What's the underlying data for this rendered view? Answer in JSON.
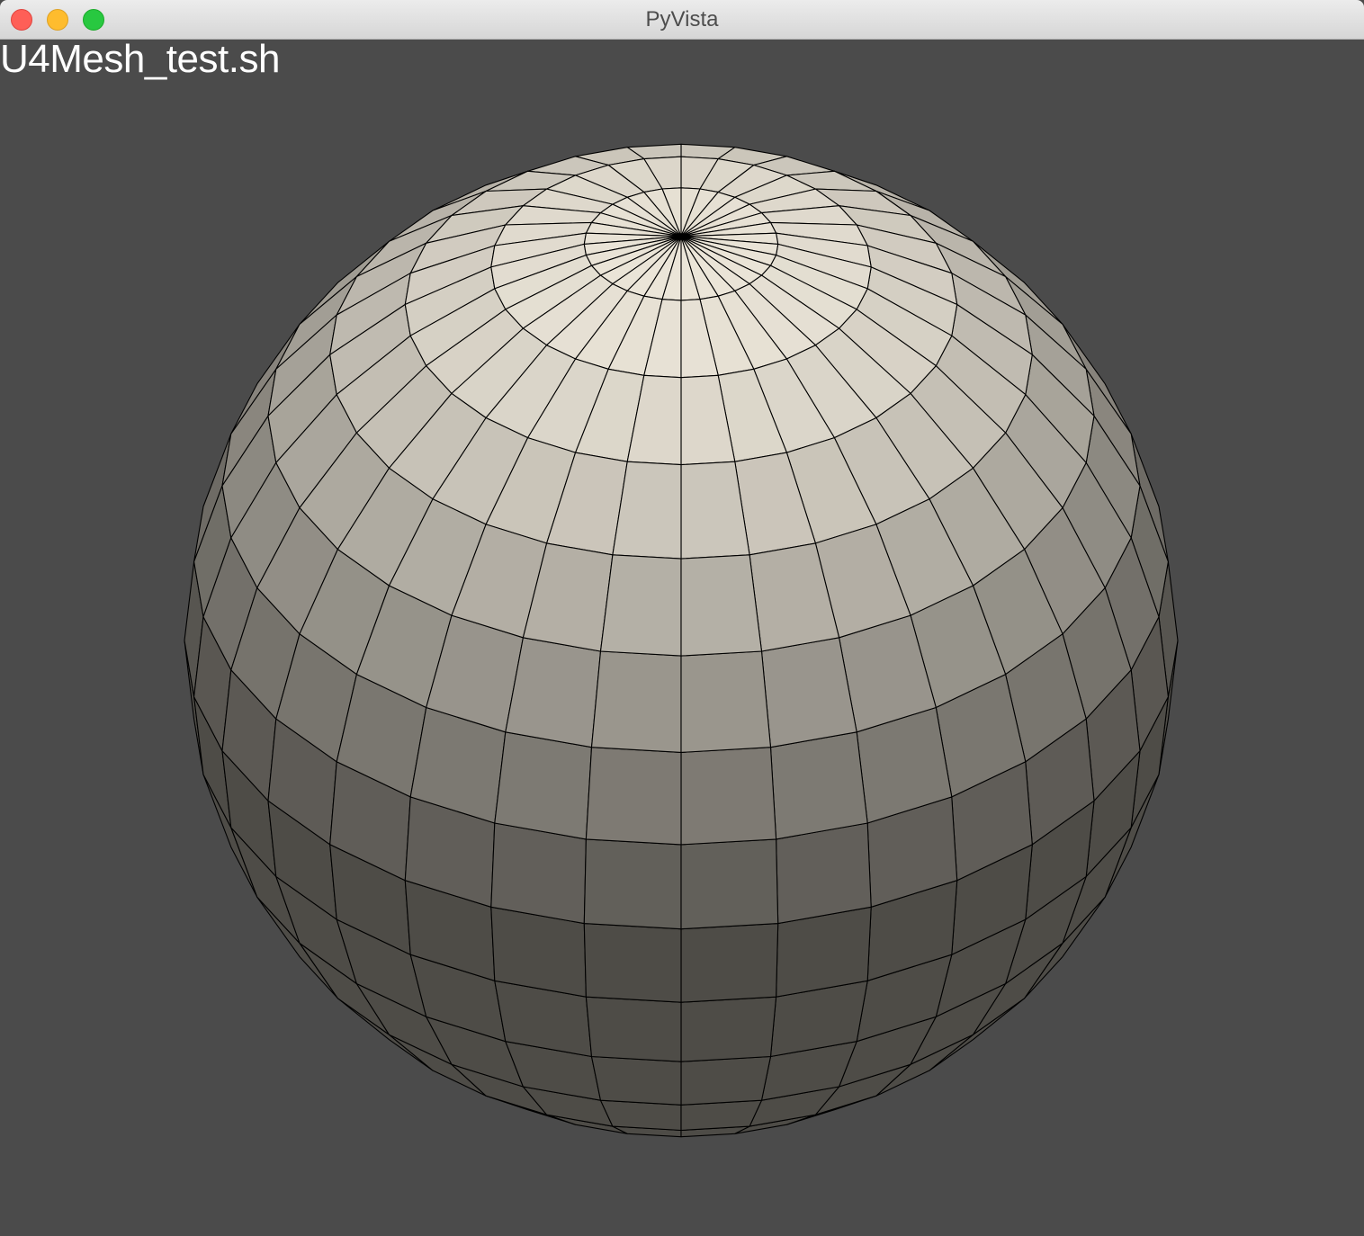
{
  "window": {
    "title": "PyVista"
  },
  "viewport": {
    "overlay_text": "U4Mesh_test.sh",
    "background": "#4b4b4b",
    "mesh": {
      "name": "sphere",
      "theta_segments": 32,
      "phi_segments": 16,
      "edge_color": "#000000",
      "surface_color": "#ebe5d8"
    }
  },
  "controls": {
    "close": "close",
    "minimize": "minimize",
    "maximize": "maximize"
  }
}
